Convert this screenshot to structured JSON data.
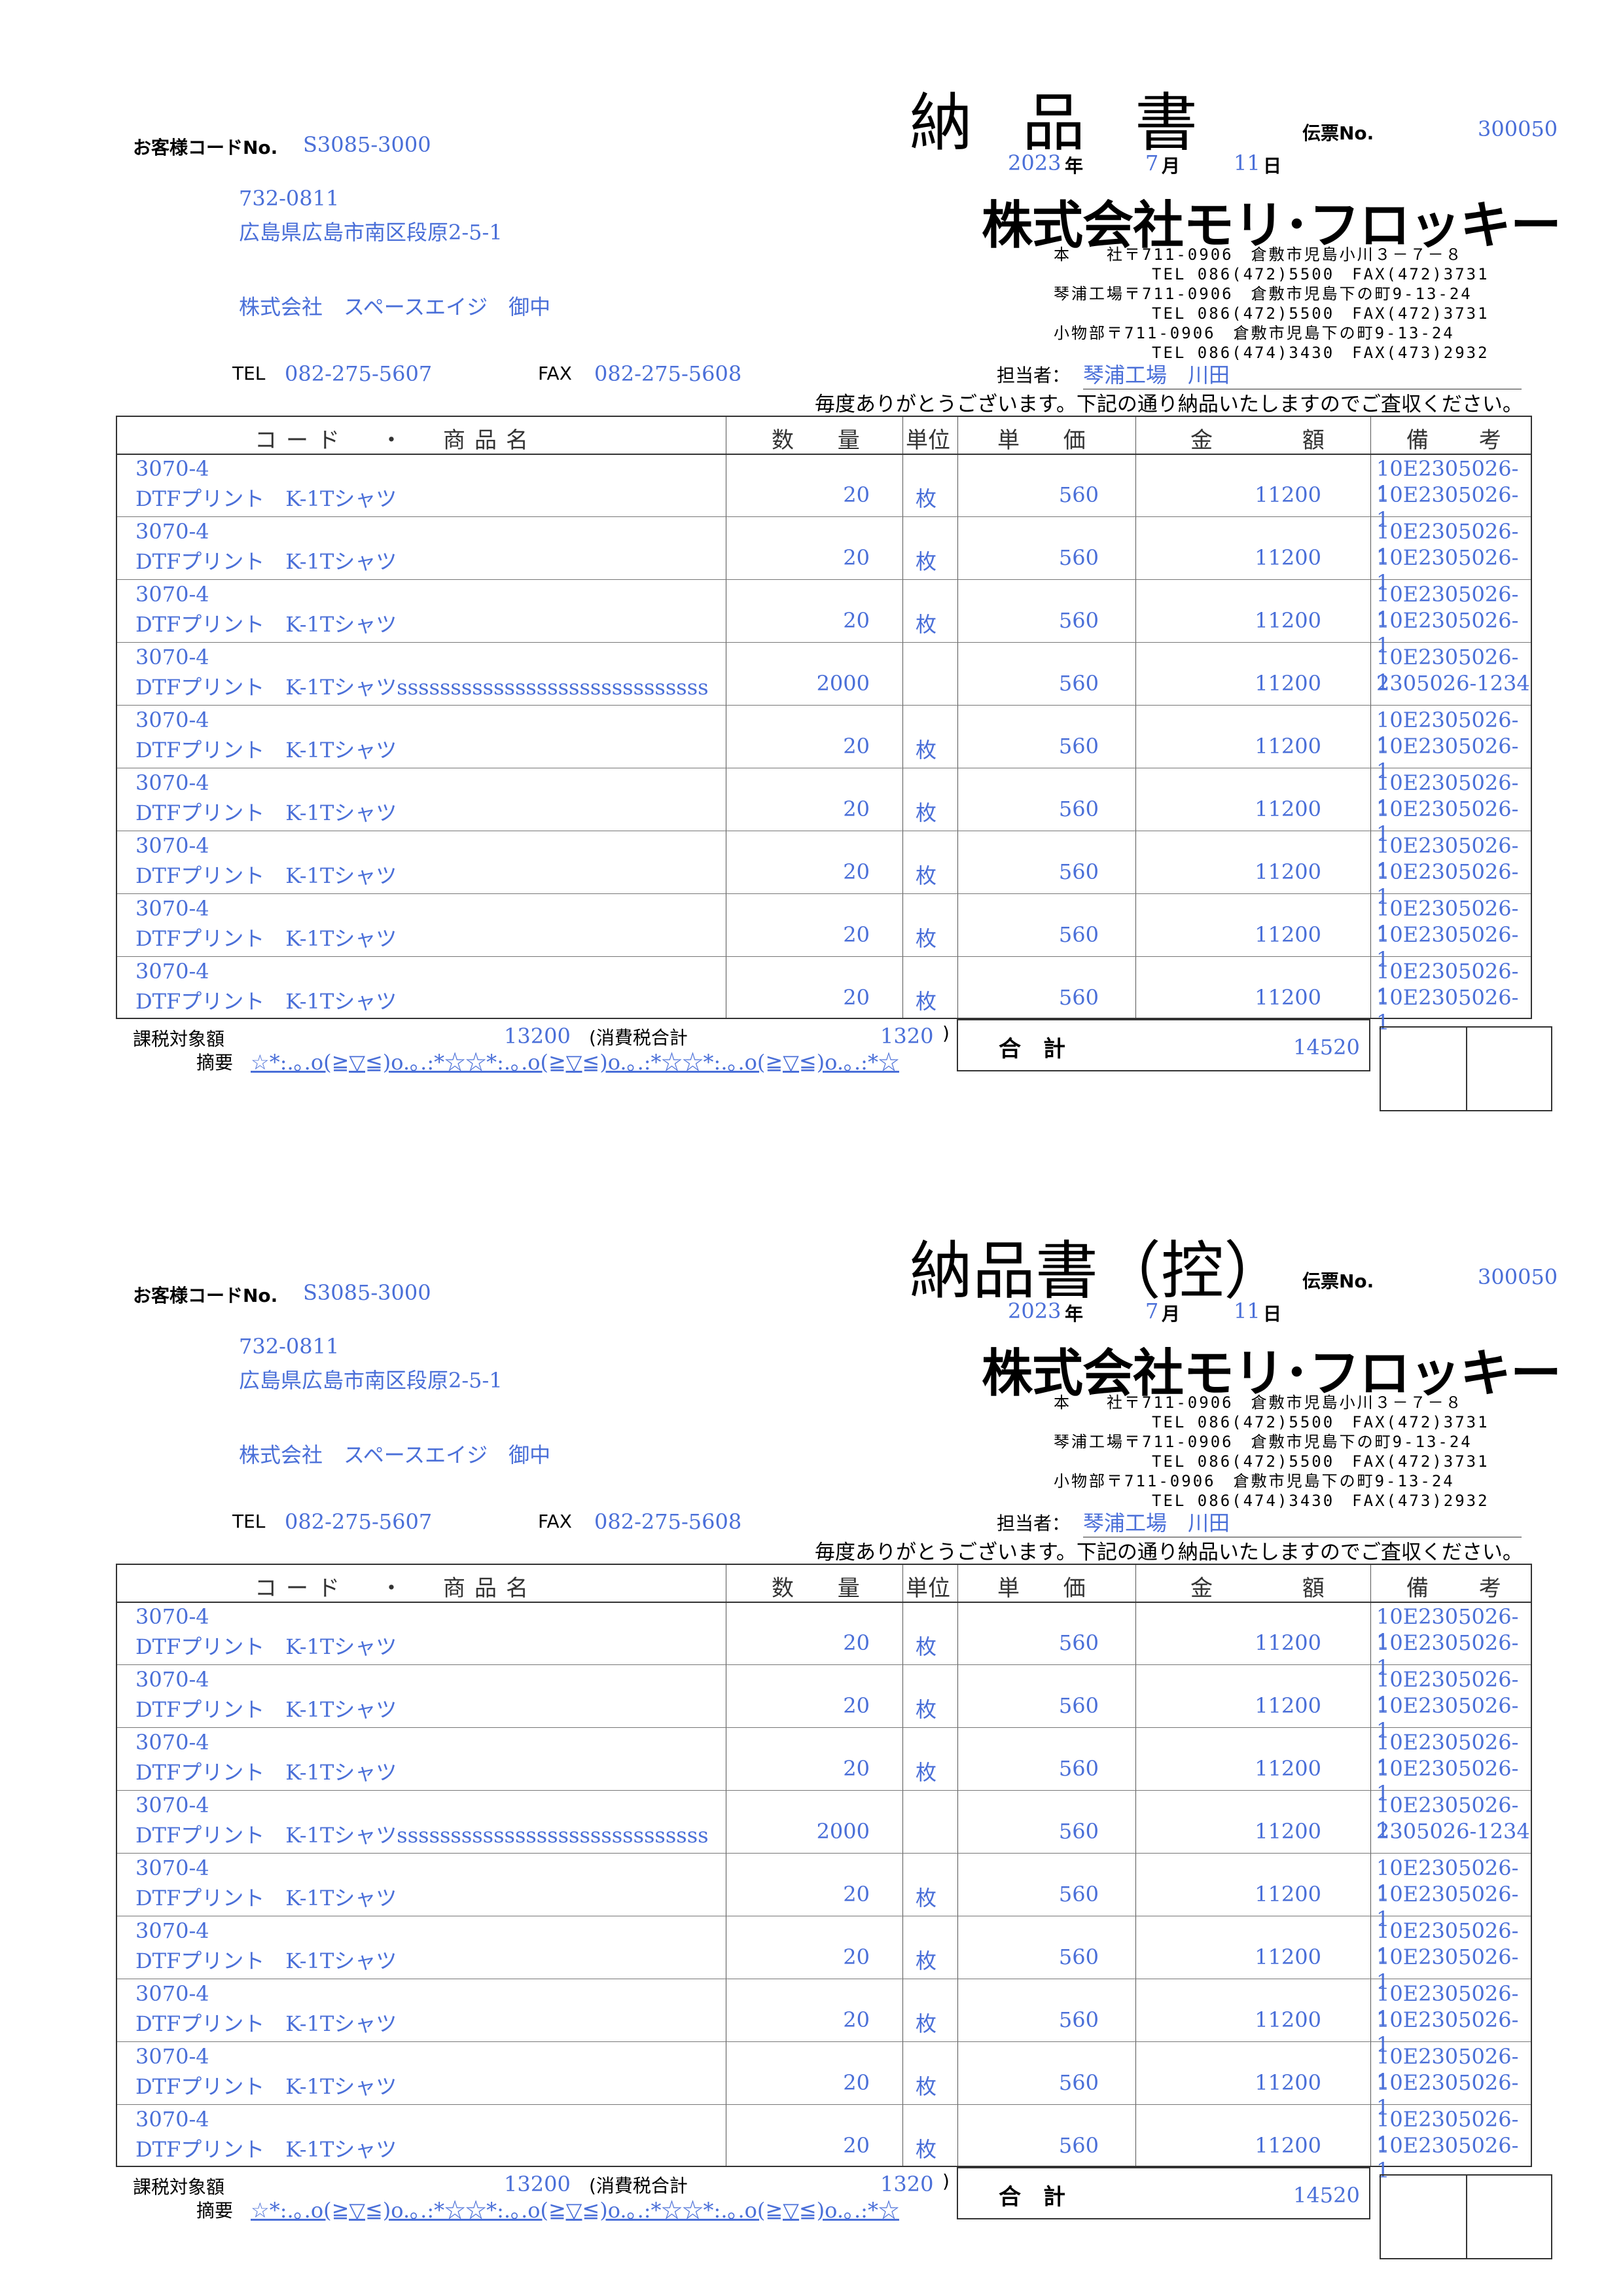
{
  "slips": [
    {
      "title": "納品書",
      "slip_no_label": "伝票No.",
      "slip_no": "300050",
      "date": {
        "year": "2023",
        "year_label": "年",
        "month": "7",
        "month_label": "月",
        "day": "11",
        "day_label": "日"
      },
      "customer_code_label": "お客様コードNo.",
      "customer_code": "S3085-3000",
      "postal": "732-0811",
      "address": "広島県広島市南区段原2-5-1",
      "customer_name": "株式会社　スペースエイジ　御中",
      "tel_label": "TEL",
      "tel": "082-275-5607",
      "fax_label": "FAX",
      "fax": "082-275-5608",
      "company": "株式会社モリ･フロッキー",
      "branches": [
        {
          "line1": "本　　社〒711-0906　倉敷市児島小川３－７－８",
          "line2": "TEL 086(472)5500　FAX(472)3731"
        },
        {
          "line1": "琴浦工場〒711-0906　倉敷市児島下の町9-13-24",
          "line2": "TEL 086(472)5500　FAX(472)3731"
        },
        {
          "line1": "小物部〒711-0906　倉敷市児島下の町9-13-24",
          "line2": "TEL 086(474)3430　FAX(473)2932"
        }
      ],
      "staff_label": "担当者：",
      "staff": "琴浦工場　川田",
      "greeting": "毎度ありがとうございます。下記の通り納品いたしますのでご査収ください。",
      "headers": {
        "code": "コード　・　商品名",
        "qty": "数 量",
        "unit": "単位",
        "price": "単 価",
        "amount": "金 額",
        "note": "備 考"
      },
      "rows": [
        {
          "code": "3070-4",
          "name": "DTFプリント　K-1Tシャツ",
          "qty": "20",
          "unit": "枚",
          "price": "560",
          "amount": "11200",
          "note1": "10E2305026-1",
          "note2": "10E2305026-1"
        },
        {
          "code": "3070-4",
          "name": "DTFプリント　K-1Tシャツ",
          "qty": "20",
          "unit": "枚",
          "price": "560",
          "amount": "11200",
          "note1": "10E2305026-1",
          "note2": "10E2305026-1"
        },
        {
          "code": "3070-4",
          "name": "DTFプリント　K-1Tシャツ",
          "qty": "20",
          "unit": "枚",
          "price": "560",
          "amount": "11200",
          "note1": "10E2305026-1",
          "note2": "10E2305026-1"
        },
        {
          "code": "3070-4",
          "name": "DTFプリント　K-1Tシャツsssssssssssssssssssssssssssss",
          "qty": "2000",
          "unit": "",
          "price": "560",
          "amount": "11200",
          "note1": "10E2305026-1",
          "note2": "2305026-1234"
        },
        {
          "code": "3070-4",
          "name": "DTFプリント　K-1Tシャツ",
          "qty": "20",
          "unit": "枚",
          "price": "560",
          "amount": "11200",
          "note1": "10E2305026-1",
          "note2": "10E2305026-1"
        },
        {
          "code": "3070-4",
          "name": "DTFプリント　K-1Tシャツ",
          "qty": "20",
          "unit": "枚",
          "price": "560",
          "amount": "11200",
          "note1": "10E2305026-1",
          "note2": "10E2305026-1"
        },
        {
          "code": "3070-4",
          "name": "DTFプリント　K-1Tシャツ",
          "qty": "20",
          "unit": "枚",
          "price": "560",
          "amount": "11200",
          "note1": "10E2305026-1",
          "note2": "10E2305026-1"
        },
        {
          "code": "3070-4",
          "name": "DTFプリント　K-1Tシャツ",
          "qty": "20",
          "unit": "枚",
          "price": "560",
          "amount": "11200",
          "note1": "10E2305026-1",
          "note2": "10E2305026-1"
        },
        {
          "code": "3070-4",
          "name": "DTFプリント　K-1Tシャツ",
          "qty": "20",
          "unit": "枚",
          "price": "560",
          "amount": "11200",
          "note1": "10E2305026-1",
          "note2": "10E2305026-1"
        }
      ],
      "taxable_label": "課税対象額",
      "taxable": "13200",
      "tax_label": "(消費税合計",
      "tax": "1320",
      "tax_close": ")",
      "total_label": "合　計",
      "total": "14520",
      "remarks_label": "摘要",
      "remarks": "☆*:.｡.o(≧▽≦)o.｡.:*☆☆*:.｡.o(≧▽≦)o.｡.:*☆☆*:.｡.o(≧▽≦)o.｡.:*☆"
    },
    {
      "title": "納品書（控）",
      "slip_no_label": "伝票No.",
      "slip_no": "300050",
      "date": {
        "year": "2023",
        "year_label": "年",
        "month": "7",
        "month_label": "月",
        "day": "11",
        "day_label": "日"
      },
      "customer_code_label": "お客様コードNo.",
      "customer_code": "S3085-3000",
      "postal": "732-0811",
      "address": "広島県広島市南区段原2-5-1",
      "customer_name": "株式会社　スペースエイジ　御中",
      "tel_label": "TEL",
      "tel": "082-275-5607",
      "fax_label": "FAX",
      "fax": "082-275-5608",
      "company": "株式会社モリ･フロッキー",
      "branches": [
        {
          "line1": "本　　社〒711-0906　倉敷市児島小川３－７－８",
          "line2": "TEL 086(472)5500　FAX(472)3731"
        },
        {
          "line1": "琴浦工場〒711-0906　倉敷市児島下の町9-13-24",
          "line2": "TEL 086(472)5500　FAX(472)3731"
        },
        {
          "line1": "小物部〒711-0906　倉敷市児島下の町9-13-24",
          "line2": "TEL 086(474)3430　FAX(473)2932"
        }
      ],
      "staff_label": "担当者：",
      "staff": "琴浦工場　川田",
      "greeting": "毎度ありがとうございます。下記の通り納品いたしますのでご査収ください。",
      "headers": {
        "code": "コード　・　商品名",
        "qty": "数 量",
        "unit": "単位",
        "price": "単 価",
        "amount": "金 額",
        "note": "備 考"
      },
      "rows": [
        {
          "code": "3070-4",
          "name": "DTFプリント　K-1Tシャツ",
          "qty": "20",
          "unit": "枚",
          "price": "560",
          "amount": "11200",
          "note1": "10E2305026-1",
          "note2": "10E2305026-1"
        },
        {
          "code": "3070-4",
          "name": "DTFプリント　K-1Tシャツ",
          "qty": "20",
          "unit": "枚",
          "price": "560",
          "amount": "11200",
          "note1": "10E2305026-1",
          "note2": "10E2305026-1"
        },
        {
          "code": "3070-4",
          "name": "DTFプリント　K-1Tシャツ",
          "qty": "20",
          "unit": "枚",
          "price": "560",
          "amount": "11200",
          "note1": "10E2305026-1",
          "note2": "10E2305026-1"
        },
        {
          "code": "3070-4",
          "name": "DTFプリント　K-1Tシャツsssssssssssssssssssssssssssss",
          "qty": "2000",
          "unit": "",
          "price": "560",
          "amount": "11200",
          "note1": "10E2305026-1",
          "note2": "2305026-1234"
        },
        {
          "code": "3070-4",
          "name": "DTFプリント　K-1Tシャツ",
          "qty": "20",
          "unit": "枚",
          "price": "560",
          "amount": "11200",
          "note1": "10E2305026-1",
          "note2": "10E2305026-1"
        },
        {
          "code": "3070-4",
          "name": "DTFプリント　K-1Tシャツ",
          "qty": "20",
          "unit": "枚",
          "price": "560",
          "amount": "11200",
          "note1": "10E2305026-1",
          "note2": "10E2305026-1"
        },
        {
          "code": "3070-4",
          "name": "DTFプリント　K-1Tシャツ",
          "qty": "20",
          "unit": "枚",
          "price": "560",
          "amount": "11200",
          "note1": "10E2305026-1",
          "note2": "10E2305026-1"
        },
        {
          "code": "3070-4",
          "name": "DTFプリント　K-1Tシャツ",
          "qty": "20",
          "unit": "枚",
          "price": "560",
          "amount": "11200",
          "note1": "10E2305026-1",
          "note2": "10E2305026-1"
        },
        {
          "code": "3070-4",
          "name": "DTFプリント　K-1Tシャツ",
          "qty": "20",
          "unit": "枚",
          "price": "560",
          "amount": "11200",
          "note1": "10E2305026-1",
          "note2": "10E2305026-1"
        }
      ],
      "taxable_label": "課税対象額",
      "taxable": "13200",
      "tax_label": "(消費税合計",
      "tax": "1320",
      "tax_close": ")",
      "total_label": "合　計",
      "total": "14520",
      "remarks_label": "摘要",
      "remarks": "☆*:.｡.o(≧▽≦)o.｡.:*☆☆*:.｡.o(≧▽≦)o.｡.:*☆☆*:.｡.o(≧▽≦)o.｡.:*☆"
    }
  ]
}
